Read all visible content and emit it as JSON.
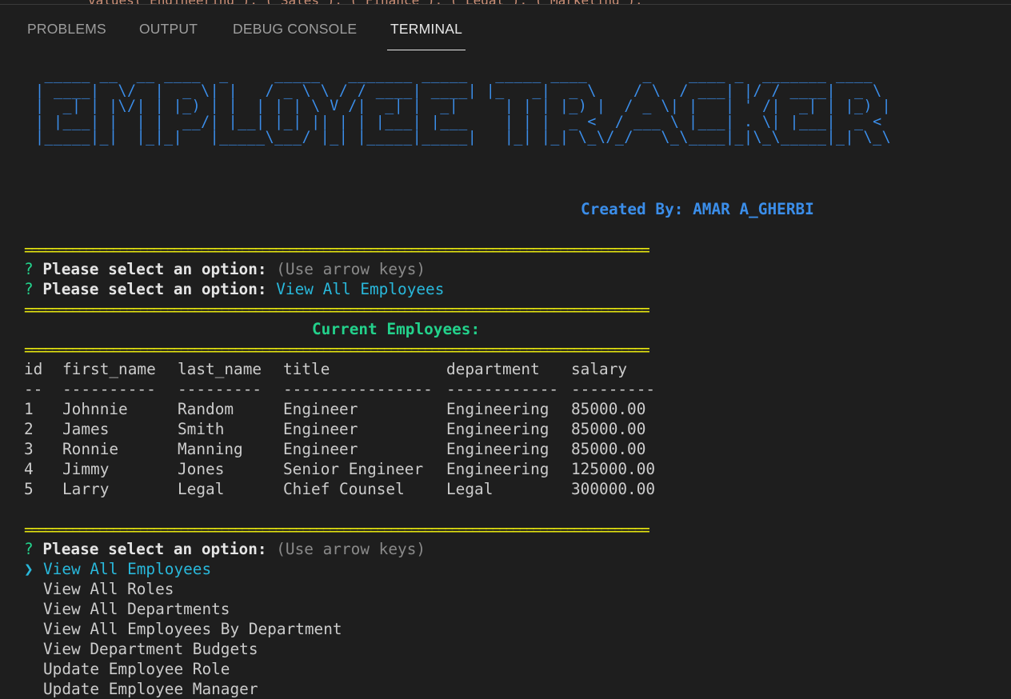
{
  "tabs": [
    {
      "label": "PROBLEMS"
    },
    {
      "label": "OUTPUT"
    },
    {
      "label": "DEBUG CONSOLE"
    },
    {
      "label": "TERMINAL"
    }
  ],
  "banner": {
    "art_lines": [
      " _____ __  __ ____  _     _____   _______ _____   _____ ____      _    ____ _  _______ ____  ",
      "| ____|  \\/  |  _ \\| |   / _ \\ \\ / / ____| ____| |_   _|  _ \\    / \\  / ___| |/ / ____|  _ \\ ",
      "|  _| | |\\/| | |_) | |  | | | \\ V /|  _| |  _|     | | | |_) |  / _ \\| |   | ' /|  _| | |_) |",
      "| |___| |  | |  __/| |__| |_| || | | |___| |___    | | |  _ <  / ___ \\ |___| . \\| |___|  _ < ",
      "|_____|_|  |_|_|   |_____\\___/ |_| |_____|_____|   |_| |_| \\_\\/_/   \\_\\____|_|\\_\\_____|_| \\_\\"
    ],
    "credit": "Created By: AMAR A_GHERBI"
  },
  "separator": "============================================================================================",
  "prompt": {
    "qmark": "?",
    "label": "Please select an option:",
    "hint": "(Use arrow keys)",
    "answer": "View All Employees"
  },
  "section_title": "Current Employees:",
  "table": {
    "headers": [
      "id",
      "first_name",
      "last_name",
      "title",
      "department",
      "salary"
    ],
    "dashes": [
      "--",
      "----------",
      "---------",
      "----------------",
      "------------",
      "---------"
    ],
    "rows": [
      [
        "1",
        "Johnnie",
        "Random",
        "Engineer",
        "Engineering",
        "85000.00"
      ],
      [
        "2",
        "James",
        "Smith",
        "Engineer",
        "Engineering",
        "85000.00"
      ],
      [
        "3",
        "Ronnie",
        "Manning",
        "Engineer",
        "Engineering",
        "85000.00"
      ],
      [
        "4",
        "Jimmy",
        "Jones",
        "Senior Engineer",
        "Engineering",
        "125000.00"
      ],
      [
        "5",
        "Larry",
        "Legal",
        "Chief Counsel",
        "Legal",
        "300000.00"
      ]
    ]
  },
  "menu": {
    "pointer": "❯",
    "items": [
      "View All Employees",
      "View All Roles",
      "View All Departments",
      "View All Employees By Department",
      "View Department Budgets",
      "Update Employee Role",
      "Update Employee Manager"
    ]
  },
  "colors": {
    "background": "#1e1e1e",
    "banner_blue": "#3b8eea",
    "separator_yellow": "#e5e510",
    "prompt_green": "#23d18b",
    "answer_cyan": "#29b8db"
  }
}
